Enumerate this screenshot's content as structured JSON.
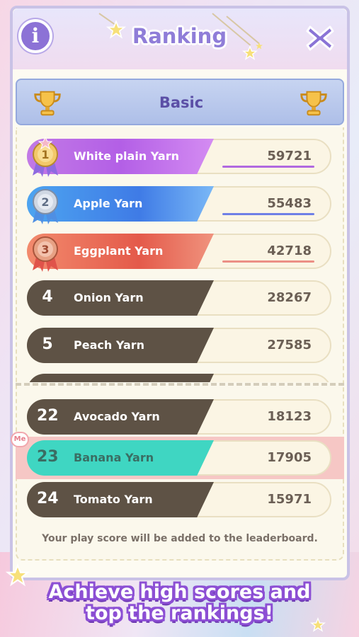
{
  "header": {
    "title": "Ranking",
    "info_icon": "i"
  },
  "tab": {
    "label": "Basic"
  },
  "top_ranks": [
    {
      "rank": 1,
      "name": "White plain Yarn",
      "score": "59721",
      "medal": "gold-medal-1"
    },
    {
      "rank": 2,
      "name": "Apple Yarn",
      "score": "55483",
      "medal": "silver-medal-2"
    },
    {
      "rank": 3,
      "name": "Eggplant Yarn",
      "score": "42718",
      "medal": "bronze-medal-3"
    },
    {
      "rank": "4",
      "name": "Onion Yarn",
      "score": "28267"
    },
    {
      "rank": "5",
      "name": "Peach Yarn",
      "score": "27585"
    }
  ],
  "nearby_ranks": [
    {
      "rank": "22",
      "name": "Avocado Yarn",
      "score": "18123"
    },
    {
      "rank": "23",
      "name": "Banana Yarn",
      "score": "17905",
      "is_me": true
    },
    {
      "rank": "24",
      "name": "Tomato Yarn",
      "score": "15971"
    }
  ],
  "me_badge": "Me",
  "footer_note": "Your play score will be added to the leaderboard.",
  "promo": {
    "line1": "Achieve high scores and",
    "line2": "top the rankings!"
  },
  "colors": {
    "accent": "#8f7dd8",
    "me_highlight": "#f6c7c5",
    "me_bar": "#3fd6c2",
    "dark_bar": "#5e5245"
  }
}
